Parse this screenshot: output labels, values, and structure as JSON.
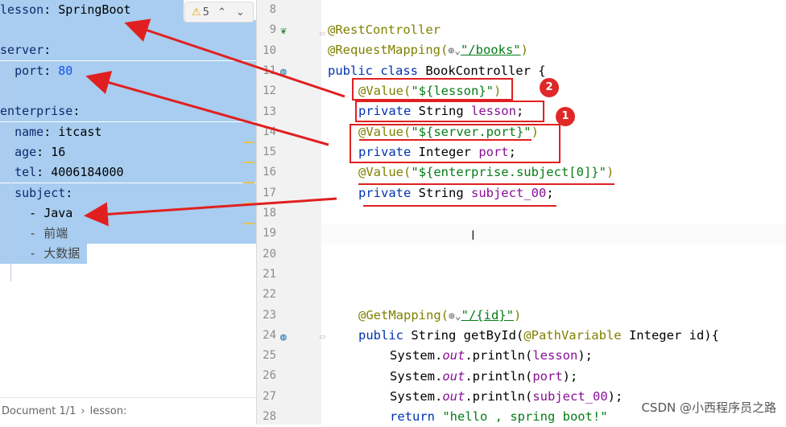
{
  "yaml": {
    "lines": [
      {
        "key": "lesson",
        "sep": ": ",
        "value": "SpringBoot",
        "indent": ""
      },
      {
        "key": "",
        "sep": "",
        "value": "",
        "indent": ""
      },
      {
        "key": "server",
        "sep": ":",
        "value": "",
        "indent": ""
      },
      {
        "key": "port",
        "sep": ": ",
        "value": "80",
        "indent": "  "
      },
      {
        "key": "",
        "sep": "",
        "value": "",
        "indent": ""
      },
      {
        "key": "enterprise",
        "sep": ":",
        "value": "",
        "indent": ""
      },
      {
        "key": "name",
        "sep": ": ",
        "value": "itcast",
        "indent": "  "
      },
      {
        "key": "age",
        "sep": ": ",
        "value": "16",
        "indent": "  "
      },
      {
        "key": "tel",
        "sep": ": ",
        "value": "4006184000",
        "indent": "  "
      },
      {
        "key": "subject",
        "sep": ":",
        "value": "",
        "indent": "  "
      },
      {
        "key": "",
        "sep": "- ",
        "value": "Java",
        "indent": "    "
      },
      {
        "key": "",
        "sep": "- ",
        "value": "前端",
        "indent": "    "
      },
      {
        "key": "",
        "sep": "- ",
        "value": "大数据",
        "indent": "    "
      }
    ],
    "warning_count": "5",
    "warning_icon": "warning-triangle-icon",
    "status": {
      "doc": "Document 1/1",
      "crumb": "lesson:"
    }
  },
  "java": {
    "line_numbers": [
      "8",
      "9",
      "10",
      "11",
      "12",
      "13",
      "14",
      "15",
      "16",
      "17",
      "18",
      "19",
      "20",
      "21",
      "22",
      "23",
      "24",
      "25",
      "26",
      "27",
      "28"
    ],
    "code": {
      "l9": "@RestController",
      "l10a": "@RequestMapping(",
      "l10b": "\"/books\"",
      "l10c": ")",
      "l11a": "public class ",
      "l11b": "BookController {",
      "l12a": "@Value(",
      "l12b": "\"${lesson}\"",
      "l12c": ")",
      "l13a": "private ",
      "l13b": "String ",
      "l13c": "lesson",
      "l13d": ";",
      "l14a": "@Value(",
      "l14b": "\"${server.port}\"",
      "l14c": ")",
      "l15a": "private ",
      "l15b": "Integer ",
      "l15c": "port",
      "l15d": ";",
      "l16a": "@Value(",
      "l16b": "\"${enterprise.subject[0]}\"",
      "l16c": ")",
      "l17a": "private ",
      "l17b": "String ",
      "l17c": "subject_00",
      "l17d": ";",
      "l23a": "@GetMapping(",
      "l23b": "\"/{id}\"",
      "l23c": ")",
      "l24a": "public ",
      "l24b": "String getById(",
      "l24c": "@PathVariable",
      "l24d": " Integer id){",
      "l25a": "System.",
      "l25b": "out",
      "l25c": ".println(",
      "l25d": "lesson",
      "l25e": ");",
      "l26a": "System.",
      "l26b": "out",
      "l26c": ".println(",
      "l26d": "port",
      "l26e": ");",
      "l27a": "System.",
      "l27b": "out",
      "l27c": ".println(",
      "l27d": "subject_00",
      "l27e": ");",
      "l28a": "return ",
      "l28b": "\"hello , spring boot!\""
    },
    "badges": [
      "2",
      "1"
    ],
    "icons": {
      "bean": "spring-bean-icon",
      "globe": "web-mapping-icon"
    }
  },
  "watermark": "CSDN @小西程序员之路",
  "colors": {
    "selection": "#a8cdf0",
    "annotation_red": "#e02020",
    "keyword": "#0033b3",
    "string": "#067d17",
    "field": "#871094"
  }
}
